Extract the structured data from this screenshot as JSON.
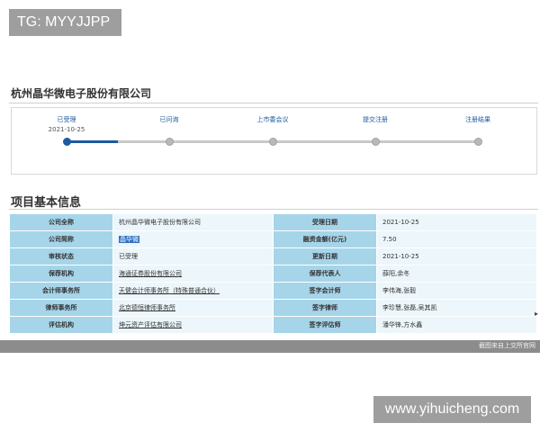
{
  "overlay": {
    "tg_label": "TG: MYYJJPP",
    "site_watermark": "www.yihuicheng.com"
  },
  "company_name": "杭州晶华微电子股份有限公司",
  "progress": {
    "steps": [
      {
        "label": "已受理",
        "date": "2021-10-25",
        "active": true
      },
      {
        "label": "已问询",
        "date": "",
        "active": false
      },
      {
        "label": "上市委会议",
        "date": "",
        "active": false
      },
      {
        "label": "提交注册",
        "date": "",
        "active": false
      },
      {
        "label": "注册结果",
        "date": "",
        "active": false
      }
    ],
    "completed_fraction": 0.127
  },
  "section_title": "项目基本信息",
  "table": {
    "rows": [
      {
        "l1": "公司全称",
        "v1": "杭州晶华微电子股份有限公司",
        "l2": "受理日期",
        "v2": "2021-10-25"
      },
      {
        "l1": "公司简称",
        "v1": "晶华微",
        "l2": "融资金额(亿元)",
        "v2": "7.50"
      },
      {
        "l1": "审核状态",
        "v1": "已受理",
        "l2": "更新日期",
        "v2": "2021-10-25"
      },
      {
        "l1": "保荐机构",
        "v1": "海通证券股份有限公司",
        "l2": "保荐代表人",
        "v2": "薛阳,余冬"
      },
      {
        "l1": "会计师事务所",
        "v1": "天健会计师事务所（特殊普通合伙）",
        "l2": "签字会计师",
        "v2": "李伟海,张毅"
      },
      {
        "l1": "律师事务所",
        "v1": "北京德恒律师事务所",
        "l2": "签字律师",
        "v2": "李珍慧,张磊,吴其凯"
      },
      {
        "l1": "评估机构",
        "v1": "坤元资产评估有限公司",
        "l2": "签字评估师",
        "v2": "潘华锋,方水鑫"
      }
    ]
  },
  "footer": {
    "source_text": "截图来自上交所官网"
  },
  "colors": {
    "accent": "#1d5aa0",
    "label_bg": "#a6d5e9",
    "value_bg": "#ecf6fb"
  }
}
